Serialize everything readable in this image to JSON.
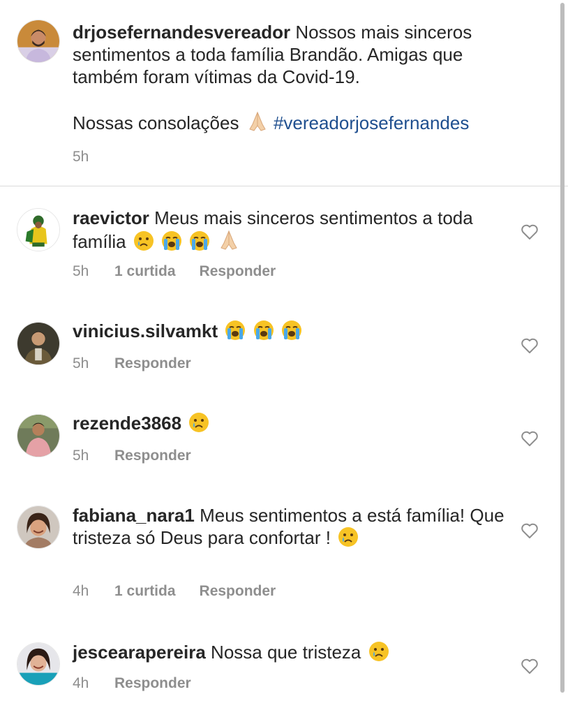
{
  "caption": {
    "username": "drjosefernandesvereador",
    "text_line1": " Nossos mais sinceros sentimentos a toda família Brandão. Amigas que também foram vítimas da Covid-19.",
    "text_line2": "Nossas consolações",
    "hashtag": "#vereadorjosefernandes",
    "time": "5h",
    "emojis": [
      "folded-hands"
    ]
  },
  "comments": [
    {
      "username": "raevictor",
      "text": " Meus mais sinceros sentimentos a toda família",
      "emojis": [
        "crying-face",
        "loudly-crying-face",
        "loudly-crying-face",
        "folded-hands"
      ],
      "time": "5h",
      "likes": "1 curtida",
      "reply": "Responder"
    },
    {
      "username": "vinicius.silvamkt",
      "text": "",
      "emojis": [
        "loudly-crying-face",
        "loudly-crying-face",
        "loudly-crying-face"
      ],
      "time": "5h",
      "likes": "",
      "reply": "Responder"
    },
    {
      "username": "rezende3868",
      "text": "",
      "emojis": [
        "crying-face"
      ],
      "time": "5h",
      "likes": "",
      "reply": "Responder"
    },
    {
      "username": "fabiana_nara1",
      "text": " Meus sentimentos a está família! Que tristeza só Deus para confortar !",
      "emojis": [
        "crying-face"
      ],
      "time": "4h",
      "likes": "1 curtida",
      "reply": "Responder"
    },
    {
      "username": "jescearapereira",
      "text": " Nossa que tristeza",
      "emojis": [
        "crying-face"
      ],
      "time": "4h",
      "likes": "",
      "reply": "Responder"
    }
  ],
  "icons": {
    "like": "heart-outline-icon"
  },
  "colors": {
    "hashtag": "#1f4f8f",
    "meta": "#8e8e8e",
    "text": "#262626",
    "divider": "#dbdbdb"
  }
}
